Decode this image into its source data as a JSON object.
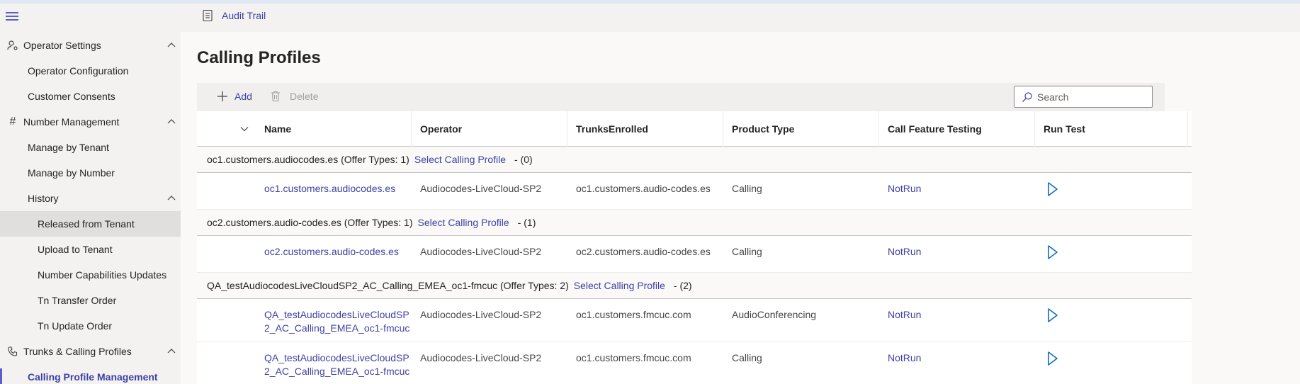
{
  "nav": {
    "items": [
      {
        "label": "Operator Settings"
      },
      {
        "label": "Operator Configuration"
      },
      {
        "label": "Customer Consents"
      },
      {
        "label": "Number Management"
      },
      {
        "label": "Manage by Tenant"
      },
      {
        "label": "Manage by Number"
      },
      {
        "label": "History"
      },
      {
        "label": "Released from Tenant"
      },
      {
        "label": "Upload to Tenant"
      },
      {
        "label": "Number Capabilities Updates"
      },
      {
        "label": "Tn Transfer Order"
      },
      {
        "label": "Tn Update Order"
      },
      {
        "label": "Trunks & Calling Profiles"
      },
      {
        "label": "Calling Profile Management"
      }
    ]
  },
  "header": {
    "audit_label": "Audit Trail"
  },
  "page": {
    "title": "Calling Profiles"
  },
  "toolbar": {
    "add_label": "Add",
    "delete_label": "Delete",
    "search_placeholder": "Search"
  },
  "table": {
    "columns": [
      "Name",
      "Operator",
      "TrunksEnrolled",
      "Product Type",
      "Call Feature Testing",
      "Run Test"
    ],
    "groups": [
      {
        "title": "oc1.customers.audiocodes.es (Offer Types: 1)",
        "link": "Select Calling Profile",
        "count": "- (0)",
        "rows": [
          {
            "name": "oc1.customers.audiocodes.es",
            "operator": "Audiocodes-LiveCloud-SP2",
            "trunks": "oc1.customers.audio-codes.es",
            "product": "Calling",
            "testing": "NotRun"
          }
        ]
      },
      {
        "title": "oc2.customers.audio-codes.es (Offer Types: 1)",
        "link": "Select Calling Profile",
        "count": "- (1)",
        "rows": [
          {
            "name": "oc2.customers.audio-codes.es",
            "operator": "Audiocodes-LiveCloud-SP2",
            "trunks": "oc2.customers.audio-codes.es",
            "product": "Calling",
            "testing": "NotRun"
          }
        ]
      },
      {
        "title": "QA_testAudiocodesLiveCloudSP2_AC_Calling_EMEA_oc1-fmcuc (Offer Types: 2)",
        "link": "Select Calling Profile",
        "count": "- (2)",
        "rows": [
          {
            "name": "QA_testAudiocodesLiveCloudSP2_AC_Calling_EMEA_oc1-fmcuc",
            "operator": "Audiocodes-LiveCloud-SP2",
            "trunks": "oc1.customers.fmcuc.com",
            "product": "AudioConferencing",
            "testing": "NotRun"
          },
          {
            "name": "QA_testAudiocodesLiveCloudSP2_AC_Calling_EMEA_oc1-fmcuc",
            "operator": "Audiocodes-LiveCloud-SP2",
            "trunks": "oc1.customers.fmcuc.com",
            "product": "Calling",
            "testing": "NotRun"
          }
        ]
      }
    ]
  },
  "colors": {
    "accent": "#5b5fc7",
    "link": "#3e41a5",
    "play": "#0f6cbd"
  }
}
